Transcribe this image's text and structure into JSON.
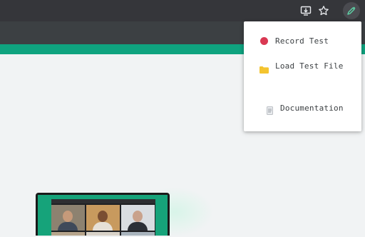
{
  "browser": {
    "icons": [
      "install-app-icon",
      "bookmark-star-icon",
      "extension-dropper-icon"
    ]
  },
  "menu": {
    "items": [
      {
        "label": "Record Test",
        "icon": "record-icon",
        "icon_color": "#d93852"
      },
      {
        "label": "Load Test File",
        "icon": "folder-icon",
        "icon_color": "#f4c430"
      },
      {
        "label": "Documentation",
        "icon": "document-icon",
        "icon_color": "#9aa0a6"
      }
    ]
  },
  "colors": {
    "accent": "#0fa37f",
    "toolbar": "#35363a",
    "subbar": "#3c4043"
  }
}
